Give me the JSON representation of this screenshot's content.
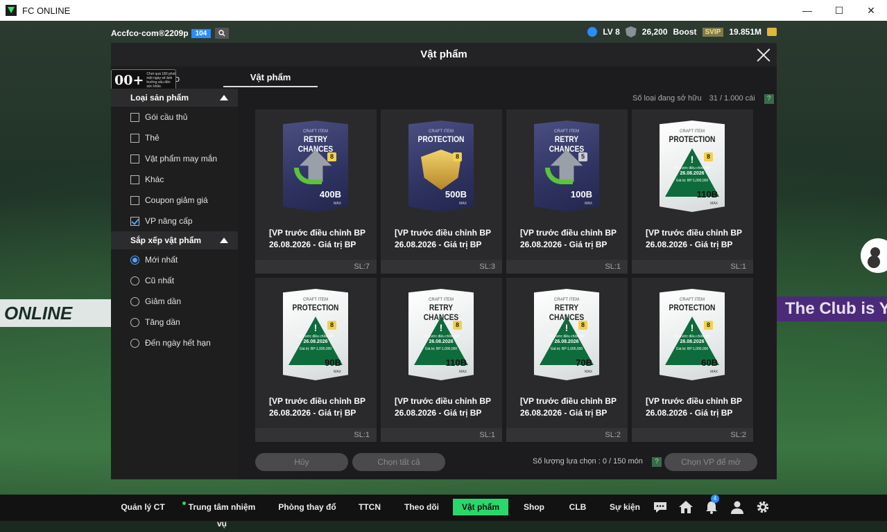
{
  "window": {
    "title": "FC ONLINE",
    "controls": [
      "—",
      "☐",
      "✕"
    ]
  },
  "background": {
    "left_banner": "ONLINE",
    "right_banner": "The Club is Y"
  },
  "topbar": {
    "account": "Accfco·com®2209p",
    "account_badge": "104",
    "level": "LV 8",
    "points": "26,200",
    "boost": "Boost",
    "svip": "SVIP",
    "balance": "19.851M"
  },
  "modal": {
    "title": "Vật phẩm",
    "tab_kho": "Kho",
    "tab_vatpham": "Vật phẩm",
    "age_badge": {
      "num": "00+",
      "text": "Chơi quá 180 phút một ngày sẽ ảnh hưởng xấu đến sức khỏe."
    }
  },
  "sidebar": {
    "section_types": "Loại sản phẩm",
    "types": [
      {
        "label": "Gói cầu thủ",
        "checked": false
      },
      {
        "label": "Thẻ",
        "checked": false
      },
      {
        "label": "Vật phẩm may mắn",
        "checked": false
      },
      {
        "label": "Khác",
        "checked": false
      },
      {
        "label": "Coupon giảm giá",
        "checked": false
      },
      {
        "label": "VP nâng cấp",
        "checked": true
      }
    ],
    "section_sort": "Sắp xếp vật phẩm",
    "sorts": [
      {
        "label": "Mới nhất",
        "selected": true
      },
      {
        "label": "Cũ nhất",
        "selected": false
      },
      {
        "label": "Giảm dần",
        "selected": false
      },
      {
        "label": "Tăng dần",
        "selected": false
      },
      {
        "label": "Đến ngày hết hạn",
        "selected": false
      }
    ]
  },
  "owned": {
    "label": "Số loại đang sở hữu",
    "value": "31 / 1.000 cái",
    "help": "?"
  },
  "cards": [
    {
      "craft_label": "CRAFT ITEM",
      "type": "RETRY CHANCES",
      "style": "dark",
      "art": "arrow",
      "level": "8",
      "bp": "400B",
      "max": "MAX",
      "title_line1": "[VP trước điều chỉnh BP",
      "title_line2": "26.08.2026 - Giá trị BP",
      "qty": "SL:7"
    },
    {
      "craft_label": "CRAFT ITEM",
      "type": "PROTECTION",
      "style": "dark",
      "art": "shield",
      "level": "8",
      "bp": "500B",
      "max": "MAX",
      "title_line1": "[VP trước điều chỉnh BP",
      "title_line2": "26.08.2026 - Giá trị BP",
      "qty": "SL:3"
    },
    {
      "craft_label": "CRAFT ITEM",
      "type": "RETRY CHANCES",
      "style": "dark",
      "art": "arrow",
      "level": "5",
      "bp": "100B",
      "max": "MAX",
      "title_line1": "[VP trước điều chỉnh BP",
      "title_line2": "26.08.2026 - Giá trị BP",
      "qty": "SL:1"
    },
    {
      "craft_label": "CRAFT ITEM",
      "type": "PROTECTION",
      "style": "light",
      "art": "warning",
      "level": "8",
      "bp": "110B",
      "max": "MAX",
      "warn_vp": "VP trước điều chỉnh BP",
      "warn_date": "26.08.2026",
      "warn_val": "Giá trị: BP:1,000,000",
      "title_line1": "[VP trước điều chỉnh BP",
      "title_line2": "26.08.2026 - Giá trị BP",
      "qty": "SL:1"
    },
    {
      "craft_label": "CRAFT ITEM",
      "type": "PROTECTION",
      "style": "light",
      "art": "warning",
      "level": "8",
      "bp": "90B",
      "max": "MAX",
      "warn_vp": "VP trước điều chỉnh BP",
      "warn_date": "26.08.2026",
      "warn_val": "Giá trị: BP:1,000,000",
      "title_line1": "[VP trước điều chỉnh BP",
      "title_line2": "26.08.2026 - Giá trị BP",
      "qty": "SL:1"
    },
    {
      "craft_label": "CRAFT ITEM",
      "type": "RETRY CHANCES",
      "style": "light",
      "art": "warning",
      "level": "8",
      "bp": "110B",
      "max": "MAX",
      "warn_vp": "VP trước điều chỉnh BP",
      "warn_date": "26.08.2026",
      "warn_val": "Giá trị: BP:1,000,000",
      "title_line1": "[VP trước điều chỉnh BP",
      "title_line2": "26.08.2026 - Giá trị BP",
      "qty": "SL:1"
    },
    {
      "craft_label": "CRAFT ITEM",
      "type": "RETRY CHANCES",
      "style": "light",
      "art": "warning",
      "level": "8",
      "bp": "70B",
      "max": "MAX",
      "warn_vp": "VP trước điều chỉnh BP",
      "warn_date": "26.08.2026",
      "warn_val": "Giá trị: BP:1,000,000",
      "title_line1": "[VP trước điều chỉnh BP",
      "title_line2": "26.08.2026 - Giá trị BP",
      "qty": "SL:2"
    },
    {
      "craft_label": "CRAFT ITEM",
      "type": "PROTECTION",
      "style": "light",
      "art": "warning",
      "level": "8",
      "bp": "60B",
      "max": "MAX",
      "warn_vp": "VP trước điều chỉnh BP",
      "warn_date": "26.08.2026",
      "warn_val": "Giá trị: BP:1,000,000",
      "title_line1": "[VP trước điều chỉnh BP",
      "title_line2": "26.08.2026 - Giá trị BP",
      "qty": "SL:2"
    }
  ],
  "actions": {
    "cancel": "Hủy",
    "select_all": "Chọn tất cả",
    "selection_label": "Số lượng lựa chọn : 0 / 150 món",
    "help": "?",
    "open": "Chọn VP để mở"
  },
  "nav": {
    "items": [
      "Quản lý CT",
      "Trung tâm nhiệm vụ",
      "Phòng thay đổ",
      "TTCN",
      "Theo dõi",
      "Vật phẩm",
      "Shop",
      "CLB",
      "Sự kiện"
    ],
    "active": "Vật phẩm",
    "notification_count": "4",
    "accent_color": "#28d86a"
  }
}
